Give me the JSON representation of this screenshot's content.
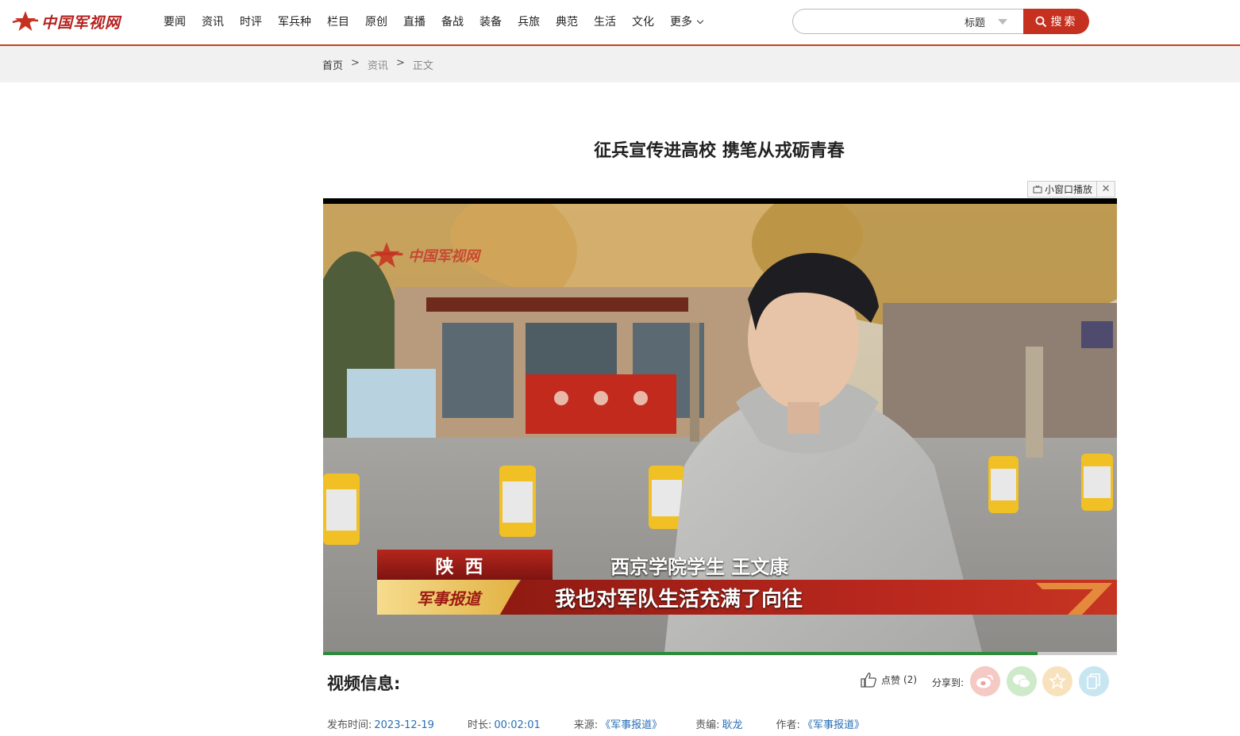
{
  "header": {
    "logo_text": "中国军视网",
    "nav": [
      "要闻",
      "资讯",
      "时评",
      "军兵种",
      "栏目",
      "原创",
      "直播",
      "备战",
      "装备",
      "兵旅",
      "典范",
      "生活",
      "文化"
    ],
    "more_label": "更多",
    "search": {
      "placeholder": "",
      "scope": "标题",
      "button_label": "搜索"
    }
  },
  "breadcrumb": {
    "home": "首页",
    "section": "资讯",
    "current": "正文",
    "separator": ">"
  },
  "article": {
    "title": "征兵宣传进高校 携笔从戎砺青春"
  },
  "player": {
    "mini_label": "小窗口播放",
    "close_glyph": "✕",
    "watermark": "中国军视网",
    "progress_fraction": 0.9,
    "lower_third": {
      "region": "陕西",
      "speaker": "西京学院学生 王文康",
      "program": "军事报道",
      "quote": "我也对军队生活充满了向往"
    }
  },
  "video_info": {
    "heading": "视频信息:",
    "like_label": "点赞",
    "like_count": "(2)",
    "share_label": "分享到:",
    "share_icons": [
      "weibo-icon",
      "wechat-icon",
      "qzone-icon",
      "copy-link-icon"
    ],
    "meta": [
      {
        "label": "发布时间:",
        "value": "2023-12-19"
      },
      {
        "label": "时长:",
        "value": "00:02:01"
      },
      {
        "label": "来源:",
        "value": "《军事报道》"
      },
      {
        "label": "责编:",
        "value": "耿龙"
      },
      {
        "label": "作者:",
        "value": "《军事报道》"
      }
    ]
  },
  "colors": {
    "brand_red": "#c6301f",
    "link_blue": "#2a6fb5",
    "progress_green": "#2e8b3c"
  }
}
